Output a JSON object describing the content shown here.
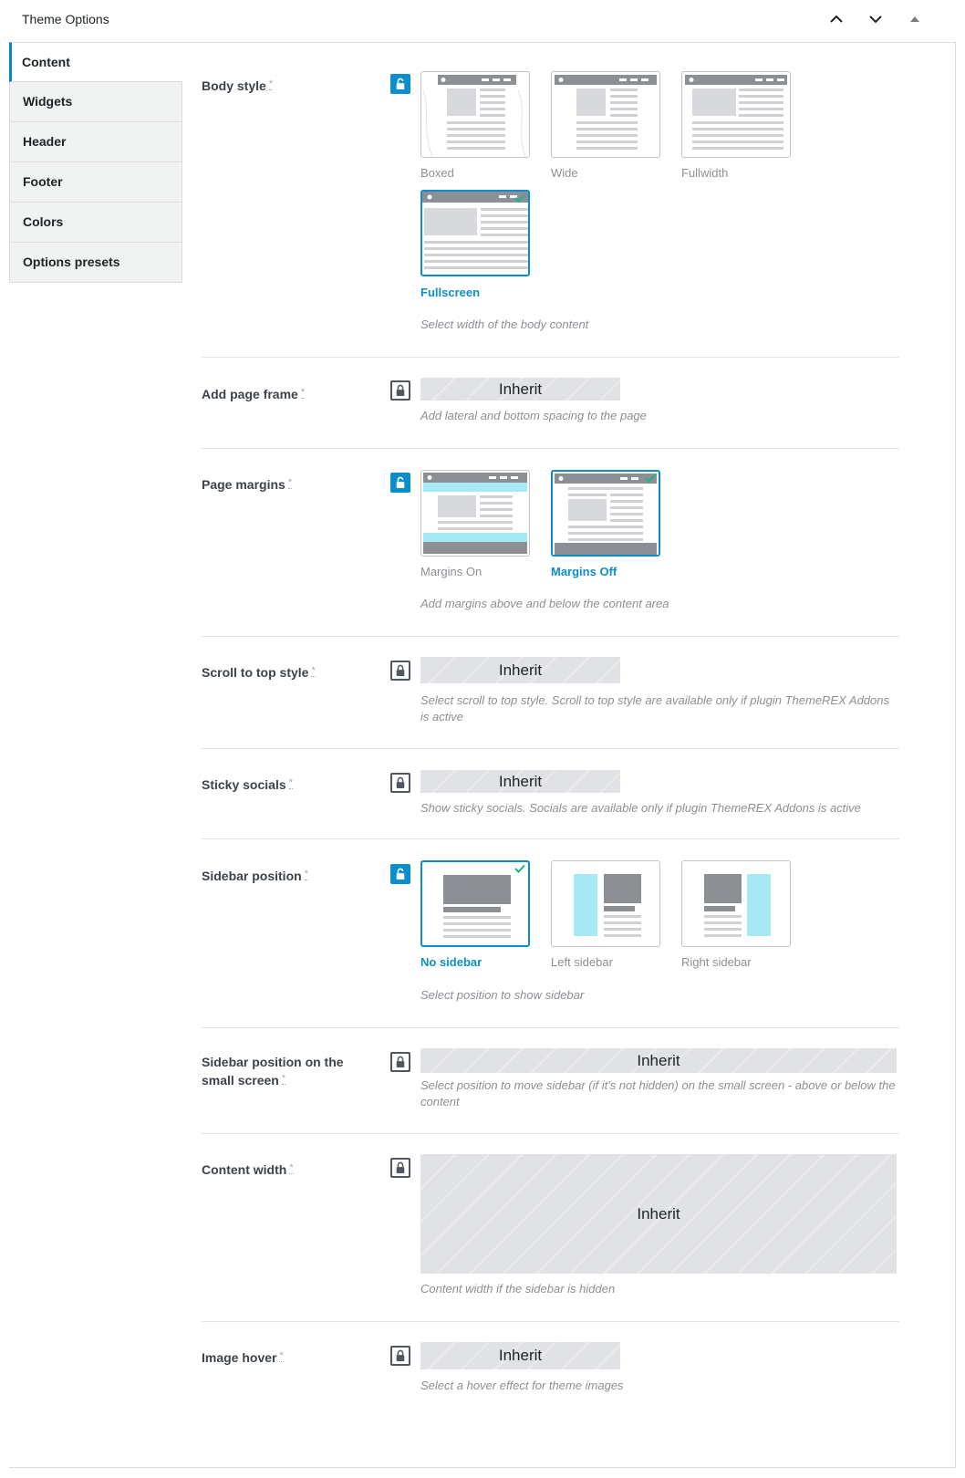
{
  "metabox": {
    "title": "Theme Options"
  },
  "tabs": [
    {
      "label": "Content"
    },
    {
      "label": "Widgets"
    },
    {
      "label": "Header"
    },
    {
      "label": "Footer"
    },
    {
      "label": "Colors"
    },
    {
      "label": "Options presets"
    }
  ],
  "options": {
    "body_style": {
      "label": "Body style",
      "star": "*",
      "choices": [
        "Boxed",
        "Wide",
        "Fullwidth",
        "Fullscreen"
      ],
      "selected": "Fullscreen",
      "desc": "Select width of the body content"
    },
    "page_frame": {
      "label": "Add page frame",
      "star": "*",
      "value": "Inherit",
      "desc": "Add lateral and bottom spacing to the page"
    },
    "page_margins": {
      "label": "Page margins",
      "star": "*",
      "choices": [
        "Margins On",
        "Margins Off"
      ],
      "selected": "Margins Off",
      "desc": "Add margins above and below the content area"
    },
    "scroll_top": {
      "label": "Scroll to top style",
      "star": "*",
      "value": "Inherit",
      "desc": "Select scroll to top style. Scroll to top style are available only if plugin ThemeREX Addons is active"
    },
    "sticky_socials": {
      "label": "Sticky socials",
      "star": "*",
      "value": "Inherit",
      "desc": "Show sticky socials. Socials are available only if plugin ThemeREX Addons is active"
    },
    "sidebar_position": {
      "label": "Sidebar position",
      "star": "*",
      "choices": [
        "No sidebar",
        "Left sidebar",
        "Right sidebar"
      ],
      "selected": "No sidebar",
      "desc": "Select position to show sidebar"
    },
    "sidebar_small": {
      "label": "Sidebar position on the small screen",
      "star": "*",
      "value": "Inherit",
      "desc": "Select position to move sidebar (if it's not hidden) on the small screen - above or below the content"
    },
    "content_width": {
      "label": "Content width",
      "star": "*",
      "value": "Inherit",
      "desc": "Content width if the sidebar is hidden"
    },
    "image_hover": {
      "label": "Image hover",
      "star": "*",
      "value": "Inherit",
      "desc": "Select a hover effect for theme images"
    }
  },
  "colors": {
    "accent": "#0c8ecd",
    "sidebar_highlight": "#a6eaf8",
    "layout_gray": "#8c8f94"
  }
}
